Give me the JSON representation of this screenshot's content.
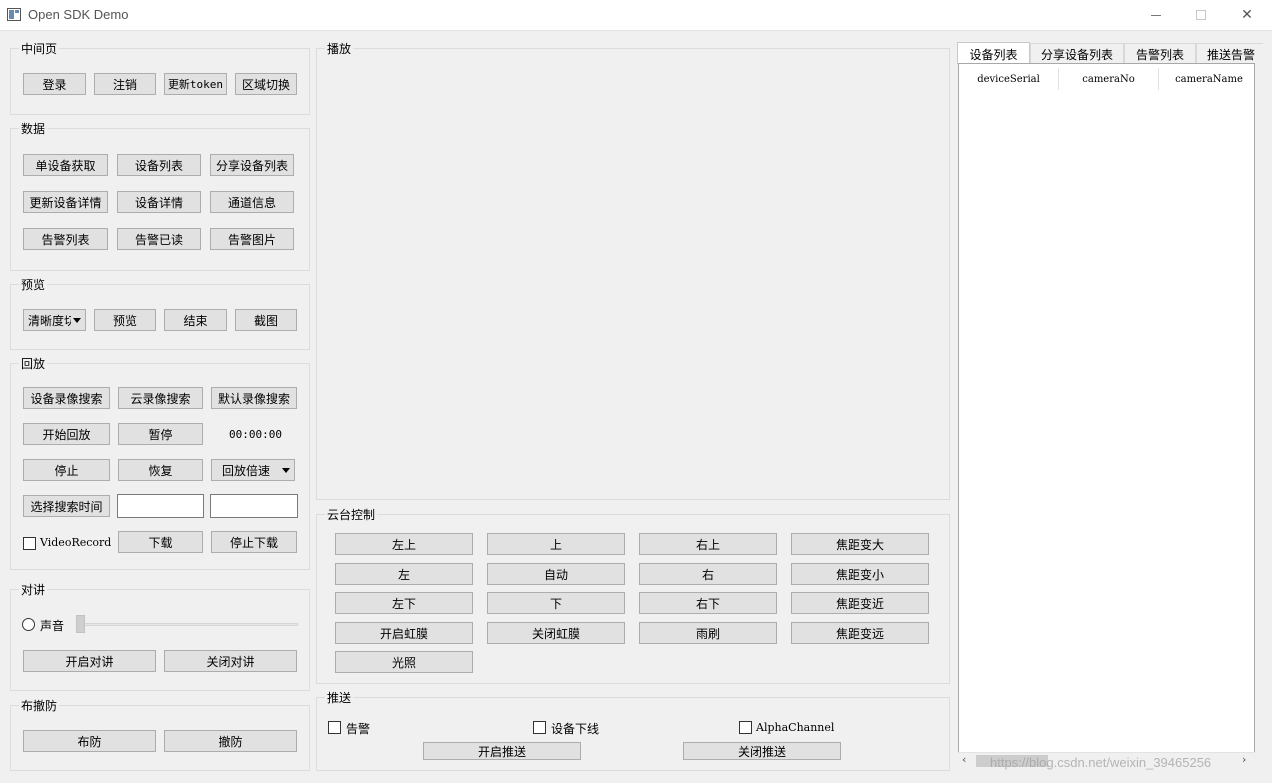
{
  "window": {
    "title": "Open SDK Demo"
  },
  "groups": {
    "middle": "中间页",
    "data": "数据",
    "preview": "预览",
    "playback": "回放",
    "talk": "对讲",
    "defense": "布撤防",
    "play": "播放",
    "ptz": "云台控制",
    "push": "推送"
  },
  "middle": {
    "login": "登录",
    "logout": "注销",
    "update_token": "更新token",
    "region_switch": "区域切换"
  },
  "data_buttons": {
    "single_device": "单设备获取",
    "device_list": "设备列表",
    "share_device_list": "分享设备列表",
    "update_device_detail": "更新设备详情",
    "device_detail": "设备详情",
    "channel_info": "通道信息",
    "alarm_list": "告警列表",
    "alarm_read": "告警已读",
    "alarm_picture": "告警图片"
  },
  "preview": {
    "clarity_select": "清晰度切换",
    "preview": "预览",
    "stop": "结束",
    "capture": "截图"
  },
  "playback": {
    "device_record_search": "设备录像搜索",
    "cloud_record_search": "云录像搜索",
    "default_record_search": "默认录像搜索",
    "start_playback": "开始回放",
    "pause": "暂停",
    "time": "00:00:00",
    "stop": "停止",
    "resume": "恢复",
    "speed": "回放倍速",
    "select_search_time": "选择搜索时间",
    "start_time_value": "",
    "end_time_value": "",
    "video_record": "VideoRecord",
    "download": "下载",
    "stop_download": "停止下载"
  },
  "talk": {
    "sound": "声音",
    "volume": 0,
    "start_talk": "开启对讲",
    "stop_talk": "关闭对讲"
  },
  "defense": {
    "arm": "布防",
    "disarm": "撤防"
  },
  "ptz": {
    "up_left": "左上",
    "up": "上",
    "up_right": "右上",
    "zoom_in": "焦距变大",
    "left": "左",
    "auto": "自动",
    "right": "右",
    "zoom_out": "焦距变小",
    "down_left": "左下",
    "down": "下",
    "down_right": "右下",
    "focus_near": "焦距变近",
    "open_iris": "开启虹膜",
    "close_iris": "关闭虹膜",
    "wiper": "雨刷",
    "focus_far": "焦距变远",
    "light": "光照"
  },
  "push": {
    "alarm": "告警",
    "device_offline": "设备下线",
    "alpha_channel": "AlphaChannel",
    "start_push": "开启推送",
    "stop_push": "关闭推送"
  },
  "tabs": [
    "设备列表",
    "分享设备列表",
    "告警列表",
    "推送告警"
  ],
  "table": {
    "columns": [
      "deviceSerial",
      "cameraNo",
      "cameraName"
    ]
  },
  "watermark": "https://blog.csdn.net/weixin_39465256"
}
